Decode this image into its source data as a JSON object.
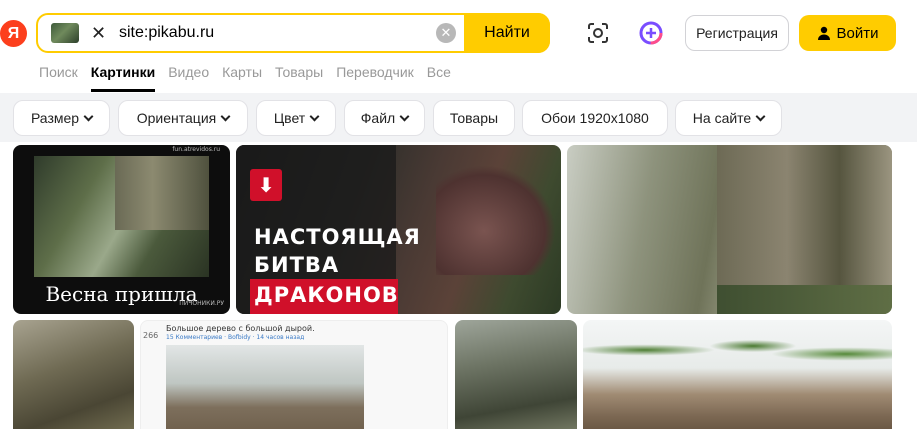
{
  "header": {
    "logo_letter": "Я",
    "search": {
      "query": "site:pikabu.ru",
      "submit_label": "Найти"
    },
    "register_label": "Регистрация",
    "login_label": "Войти"
  },
  "tabs": [
    {
      "label": "Поиск",
      "active": false
    },
    {
      "label": "Картинки",
      "active": true
    },
    {
      "label": "Видео",
      "active": false
    },
    {
      "label": "Карты",
      "active": false
    },
    {
      "label": "Товары",
      "active": false
    },
    {
      "label": "Переводчик",
      "active": false
    },
    {
      "label": "Все",
      "active": false
    }
  ],
  "filters": [
    {
      "label": "Размер",
      "dropdown": true
    },
    {
      "label": "Ориентация",
      "dropdown": true
    },
    {
      "label": "Цвет",
      "dropdown": true
    },
    {
      "label": "Файл",
      "dropdown": true
    },
    {
      "label": "Товары",
      "dropdown": false
    },
    {
      "label": "Обои 1920x1080",
      "dropdown": false
    },
    {
      "label": "На сайте",
      "dropdown": true
    }
  ],
  "results": {
    "tile1": {
      "caption": "Весна пришла",
      "watermark_top": "fun.atrevidos.ru",
      "watermark_bottom": "ПИЧОНИКИ.РУ"
    },
    "tile2": {
      "line1": "НАСТОЯЩАЯ",
      "line2": "БИТВА",
      "line3": "ДРАКОНОВ"
    },
    "tile5": {
      "title": "Большое дерево с большой дырой.",
      "votes": "266",
      "meta": "15 Комментариев · Bofbidy · 14 часов назад"
    }
  },
  "colors": {
    "accent_yellow": "#ffcc00",
    "logo_red": "#fc3f1d"
  }
}
